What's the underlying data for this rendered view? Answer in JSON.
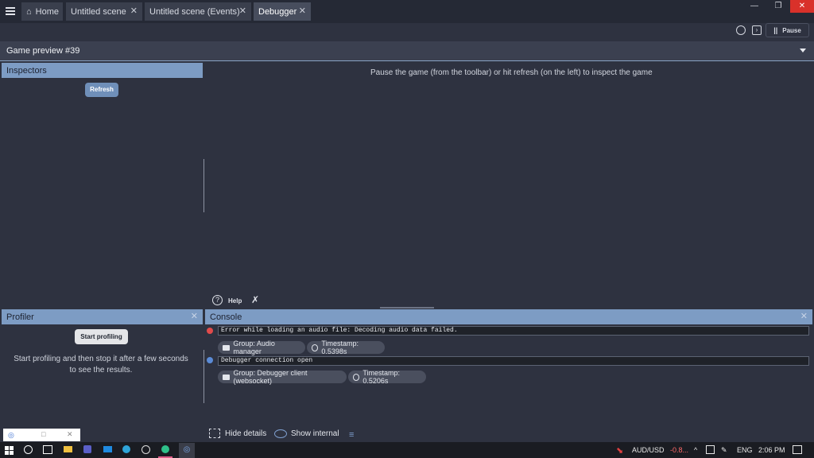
{
  "tabs": [
    {
      "label": "Home",
      "icon": "home-icon"
    },
    {
      "label": "Untitled scene",
      "close": "✕"
    },
    {
      "label": "Untitled scene (Events)",
      "close": "✕"
    },
    {
      "label": "Debugger",
      "close": "✕"
    }
  ],
  "window_controls": {
    "minimize": "—",
    "restore": "❐",
    "close": "✕"
  },
  "toolbar": {
    "pause_label": "Pause"
  },
  "preview": {
    "title": "Game preview #39"
  },
  "inspectors": {
    "title": "Inspectors",
    "refresh": "Refresh"
  },
  "hint": "Pause the game (from the toolbar) or hit refresh (on the left) to inspect the game",
  "help": {
    "label": "Help"
  },
  "profiler": {
    "title": "Profiler",
    "start": "Start profiling",
    "message": "Start profiling and then stop it after a few seconds to see the results."
  },
  "console": {
    "title": "Console",
    "logs": [
      {
        "text": "Error while loading an audio file: Decoding audio data failed.",
        "group": "Group: Audio manager",
        "timestamp": "Timestamp: 0.5398s",
        "level_color": "#e14b4b"
      },
      {
        "text": "Debugger connection open",
        "group": "Group: Debugger client (websocket)",
        "timestamp": "Timestamp: 0.5206s",
        "level_color": "#5b8bd6"
      }
    ],
    "hide_details": "Hide details",
    "show_internal": "Show internal"
  },
  "taskbar": {
    "ticker": "AUD/USD",
    "ticker_change": "-0.8...",
    "lang": "ENG",
    "time": "2:06 PM"
  },
  "colors": {
    "accent": "#7d9cc4",
    "bg": "#2e3240",
    "error": "#e14b4b",
    "info": "#5b8bd6"
  }
}
